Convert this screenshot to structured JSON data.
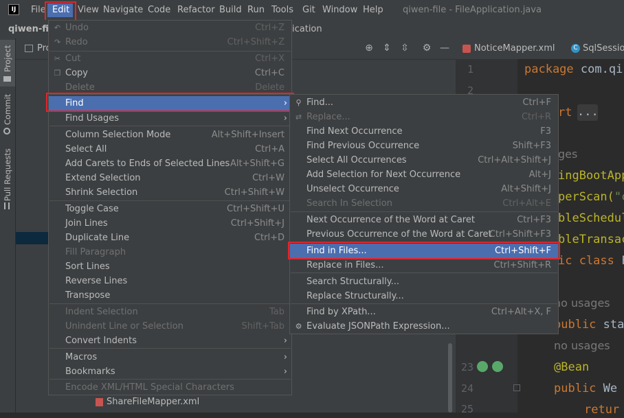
{
  "menubar": {
    "logo": "IJ",
    "items": [
      "File",
      "Edit",
      "View",
      "Navigate",
      "Code",
      "Refactor",
      "Build",
      "Run",
      "Tools",
      "Git",
      "Window",
      "Help"
    ],
    "window_title": "qiwen-file - FileApplication.java"
  },
  "navbar": {
    "project_name": "qiwen-file",
    "breadcrumb_tail": "ication"
  },
  "toolstrip": {
    "tabs": [
      "Project",
      "Commit",
      "Pull Requests"
    ]
  },
  "project_panel": {
    "title": "Pro",
    "tree_file": "ShareFileMapper.xml"
  },
  "editor": {
    "tabs": [
      "NoticeMapper.xml",
      "SqlSession"
    ],
    "line_numbers": [
      "1",
      "2",
      "23",
      "24",
      "25"
    ],
    "code": {
      "line1_kw": "package",
      "line1_rest": " com.qi",
      "line3_frag": "rt",
      "fold_chip": "...",
      "usages_frag": "ges",
      "line5": "ingBootApp",
      "line6_pre": "perScan(",
      "line6_str": "\"c",
      "line7": "bleSchedul",
      "line8": "bleTransac",
      "line9_kw": "ic class",
      "line9_rest": " F",
      "no_usages_1": "no usages",
      "public_sta_kw": "public",
      "public_sta_rest": " sta",
      "no_usages_2": "no usages",
      "bean": "@Bean",
      "public_web_kw": "public",
      "public_web_rest": " We",
      "return_frag": "retur"
    }
  },
  "edit_menu": {
    "items": [
      {
        "label": "Undo",
        "shortcut": "Ctrl+Z",
        "disabled": true
      },
      {
        "label": "Redo",
        "shortcut": "Ctrl+Shift+Z",
        "disabled": true
      },
      {
        "label": "Cut",
        "shortcut": "Ctrl+X",
        "disabled": true
      },
      {
        "label": "Copy",
        "shortcut": "Ctrl+C",
        "disabled": false
      },
      {
        "label": "Delete",
        "shortcut": "Delete",
        "disabled": true
      },
      {
        "label": "Find",
        "shortcut": "",
        "submenu": true,
        "selected": true
      },
      {
        "label": "Find Usages",
        "shortcut": "",
        "submenu": true
      },
      {
        "label": "Column Selection Mode",
        "shortcut": "Alt+Shift+Insert"
      },
      {
        "label": "Select All",
        "shortcut": "Ctrl+A"
      },
      {
        "label": "Add Carets to Ends of Selected Lines",
        "shortcut": "Alt+Shift+G"
      },
      {
        "label": "Extend Selection",
        "shortcut": "Ctrl+W"
      },
      {
        "label": "Shrink Selection",
        "shortcut": "Ctrl+Shift+W"
      },
      {
        "label": "Toggle Case",
        "shortcut": "Ctrl+Shift+U"
      },
      {
        "label": "Join Lines",
        "shortcut": "Ctrl+Shift+J"
      },
      {
        "label": "Duplicate Line",
        "shortcut": "Ctrl+D"
      },
      {
        "label": "Fill Paragraph",
        "shortcut": "",
        "disabled": true
      },
      {
        "label": "Sort Lines",
        "shortcut": ""
      },
      {
        "label": "Reverse Lines",
        "shortcut": ""
      },
      {
        "label": "Transpose",
        "shortcut": ""
      },
      {
        "label": "Indent Selection",
        "shortcut": "Tab",
        "disabled": true
      },
      {
        "label": "Unindent Line or Selection",
        "shortcut": "Shift+Tab",
        "disabled": true
      },
      {
        "label": "Convert Indents",
        "shortcut": "",
        "submenu": true
      },
      {
        "label": "Macros",
        "shortcut": "",
        "submenu": true
      },
      {
        "label": "Bookmarks",
        "shortcut": "",
        "submenu": true
      },
      {
        "label": "Encode XML/HTML Special Characters",
        "shortcut": "",
        "disabled": true
      }
    ]
  },
  "find_menu": {
    "items": [
      {
        "label": "Find...",
        "shortcut": "Ctrl+F"
      },
      {
        "label": "Replace...",
        "shortcut": "Ctrl+R",
        "disabled": true
      },
      {
        "label": "Find Next Occurrence",
        "shortcut": "F3"
      },
      {
        "label": "Find Previous Occurrence",
        "shortcut": "Shift+F3"
      },
      {
        "label": "Select All Occurrences",
        "shortcut": "Ctrl+Alt+Shift+J"
      },
      {
        "label": "Add Selection for Next Occurrence",
        "shortcut": "Alt+J"
      },
      {
        "label": "Unselect Occurrence",
        "shortcut": "Alt+Shift+J"
      },
      {
        "label": "Search In Selection",
        "shortcut": "Ctrl+Alt+E",
        "disabled": true
      },
      {
        "label": "Next Occurrence of the Word at Caret",
        "shortcut": "Ctrl+F3"
      },
      {
        "label": "Previous Occurrence of the Word at Caret",
        "shortcut": "Ctrl+Shift+F3"
      },
      {
        "label": "Find in Files...",
        "shortcut": "Ctrl+Shift+F",
        "selected": true
      },
      {
        "label": "Replace in Files...",
        "shortcut": "Ctrl+Shift+R"
      },
      {
        "label": "Search Structurally...",
        "shortcut": ""
      },
      {
        "label": "Replace Structurally...",
        "shortcut": ""
      },
      {
        "label": "Find by XPath...",
        "shortcut": "Ctrl+Alt+X, F"
      },
      {
        "label": "Evaluate JSONPath Expression...",
        "shortcut": ""
      }
    ]
  },
  "colors": {
    "menu_bg": "#3c3f41",
    "selection": "#4b6eaf",
    "highlight_box": "#e3242b",
    "editor_bg": "#2b2b2b"
  }
}
